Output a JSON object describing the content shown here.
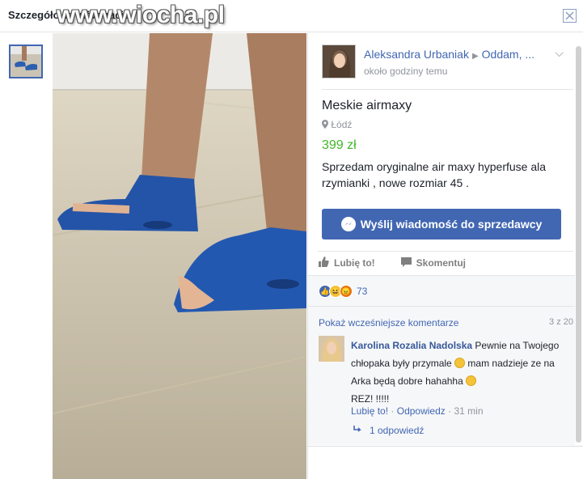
{
  "header": {
    "title": "Szczegółowe informacje",
    "watermark": "www.wiocha.pl"
  },
  "listing": {
    "author": "Aleksandra Urbaniak",
    "group": "Oddam, ...",
    "posted_time": "około godziny temu",
    "title": "Meskie airmaxy",
    "location": "Łódź",
    "price": "399 zł",
    "description": "Sprzedam oryginalne air maxy hyperfuse ala rzymianki , nowe rozmiar 45 .",
    "message_button": "Wyślij wiadomość do sprzedawcy"
  },
  "actions": {
    "like": "Lubię to!",
    "comment": "Skomentuj"
  },
  "reactions": {
    "count": "73"
  },
  "comments": {
    "previous_link": "Pokaż wcześniejsze komentarze",
    "page_count": "3 z 20",
    "items": [
      {
        "author": "Karolina Rozalia Nadolska",
        "text_part1": "Pewnie na Twojego chłopaka były przymale",
        "text_part2": "mam nadzieje ze na Arka będą dobre hahahha",
        "text_part3": "REZ! !!!!!",
        "like": "Lubię to!",
        "reply": "Odpowiedz",
        "time": "31 min",
        "replies": "1 odpowiedź"
      }
    ]
  },
  "colors": {
    "accent": "#4267b2",
    "price": "#42b72a",
    "panel_bg": "#f6f7f9"
  }
}
